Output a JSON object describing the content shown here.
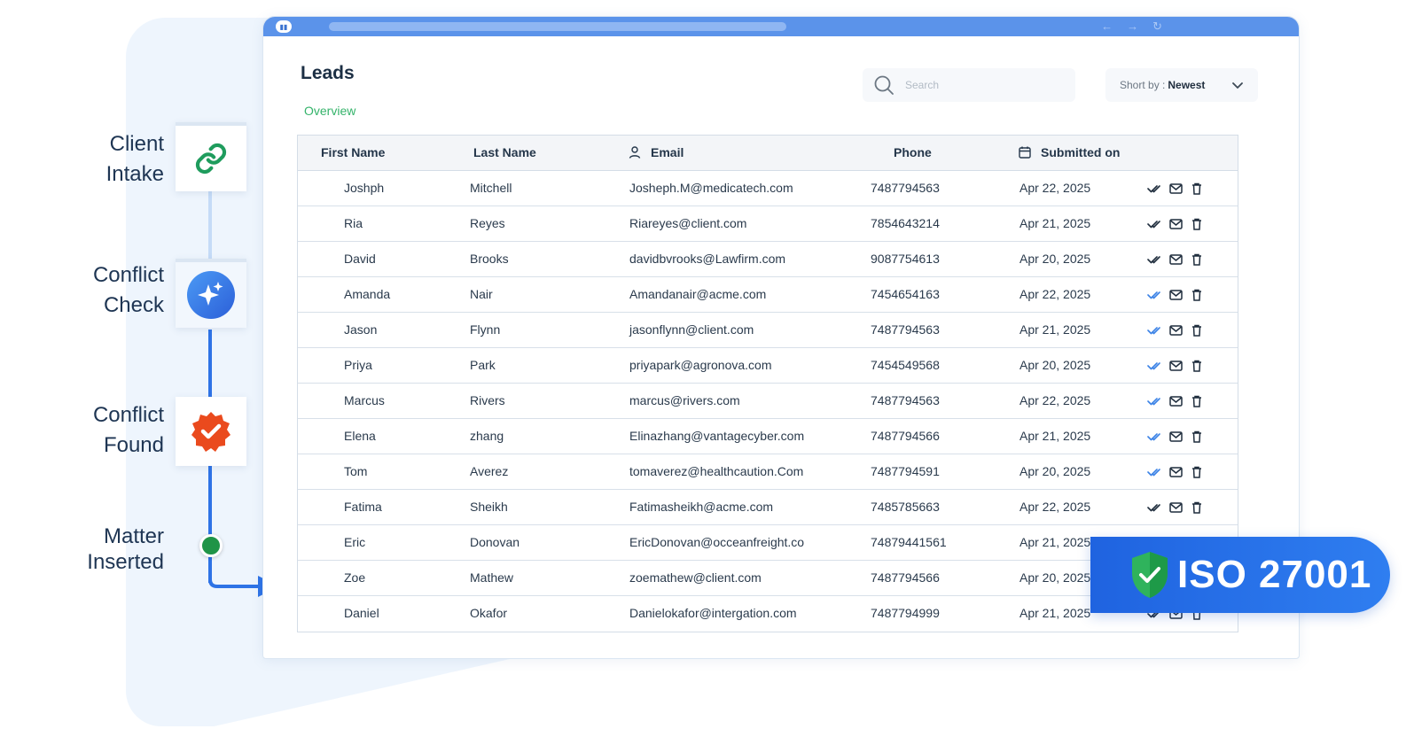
{
  "workflow": {
    "steps": [
      {
        "line1": "Client",
        "line2": "Intake",
        "icon": "link-icon"
      },
      {
        "line1": "Conflict",
        "line2": "Check",
        "icon": "sparkle-icon"
      },
      {
        "line1": "Conflict",
        "line2": "Found",
        "icon": "badge-check-icon"
      },
      {
        "line1": "Matter",
        "line2": "Inserted",
        "icon": "green-dot"
      }
    ]
  },
  "page": {
    "title": "Leads",
    "tab": "Overview",
    "search_placeholder": "Search",
    "sort_label": "Short by :",
    "sort_value": "Newest"
  },
  "table": {
    "headers": {
      "first_name": "First Name",
      "last_name": "Last Name",
      "email": "Email",
      "phone": "Phone",
      "submitted": "Submitted on"
    },
    "rows": [
      {
        "first": "Joshph",
        "last": "Mitchell",
        "email": "Josheph.M@medicatech.com",
        "phone": "7487794563",
        "date": "Apr 22, 2025",
        "read": false
      },
      {
        "first": "Ria",
        "last": "Reyes",
        "email": "Riareyes@client.com",
        "phone": "7854643214",
        "date": "Apr 21, 2025",
        "read": false
      },
      {
        "first": "David",
        "last": "Brooks",
        "email": "davidbvrooks@Lawfirm.com",
        "phone": "9087754613",
        "date": "Apr 20, 2025",
        "read": false
      },
      {
        "first": "Amanda",
        "last": "Nair",
        "email": "Amandanair@acme.com",
        "phone": "7454654163",
        "date": "Apr 22, 2025",
        "read": true
      },
      {
        "first": "Jason",
        "last": "Flynn",
        "email": "jasonflynn@client.com",
        "phone": "7487794563",
        "date": "Apr 21, 2025",
        "read": true
      },
      {
        "first": "Priya",
        "last": "Park",
        "email": "priyapark@agronova.com",
        "phone": "7454549568",
        "date": "Apr 20, 2025",
        "read": true
      },
      {
        "first": "Marcus",
        "last": "Rivers",
        "email": "marcus@rivers.com",
        "phone": "7487794563",
        "date": "Apr 22, 2025",
        "read": true
      },
      {
        "first": "Elena",
        "last": "zhang",
        "email": "Elinazhang@vantagecyber.com",
        "phone": "7487794566",
        "date": "Apr 21, 2025",
        "read": true
      },
      {
        "first": "Tom",
        "last": "Averez",
        "email": "tomaverez@healthcaution.Com",
        "phone": "7487794591",
        "date": "Apr 20, 2025",
        "read": true
      },
      {
        "first": "Fatima",
        "last": "Sheikh",
        "email": "Fatimasheikh@acme.com",
        "phone": "7485785663",
        "date": "Apr 22, 2025",
        "read": false
      },
      {
        "first": "Eric",
        "last": "Donovan",
        "email": "EricDonovan@occeanfreight.co",
        "phone": "74879441561",
        "date": "Apr 21, 2025",
        "read": false
      },
      {
        "first": "Zoe",
        "last": "Mathew",
        "email": "zoemathew@client.com",
        "phone": "7487794566",
        "date": "Apr 20, 2025",
        "read": false
      },
      {
        "first": "Daniel",
        "last": "Okafor",
        "email": "Danielokafor@intergation.com",
        "phone": "7487794999",
        "date": "Apr 21, 2025",
        "read": false
      }
    ]
  },
  "badge": {
    "text": "ISO 27001"
  },
  "colors": {
    "accent": "#2e73e6",
    "green": "#34b36a",
    "read_check": "#3b82e6",
    "unread_check": "#1f2d3d",
    "alert": "#ea4a1d"
  }
}
